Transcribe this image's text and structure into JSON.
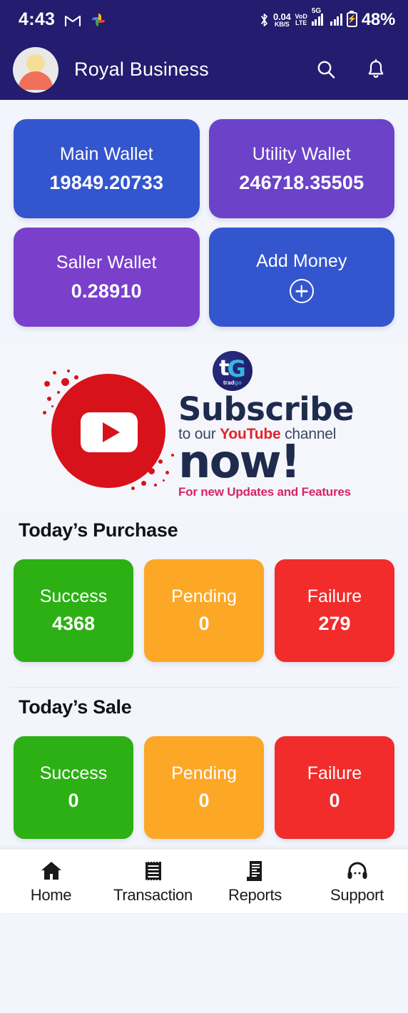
{
  "status_bar": {
    "clock": "4:43",
    "gmail_icon": "gmail-icon",
    "photos_icon": "google-photos-icon",
    "bluetooth_icon": "bluetooth-icon",
    "net_speed_value": "0.04",
    "net_speed_unit": "KB/S",
    "volte_line1": "VoD",
    "volte_line2": "LTE",
    "network_type": "5G",
    "battery_percent": "48%"
  },
  "app_bar": {
    "title": "Royal Business",
    "avatar": "user-avatar",
    "search_icon": "search-icon",
    "bell_icon": "notification-bell-icon"
  },
  "wallets": [
    {
      "label": "Main Wallet",
      "value": "19849.20733",
      "color": "#3355CE"
    },
    {
      "label": "Utility Wallet",
      "value": "246718.35505",
      "color": "#6B42C8"
    },
    {
      "label": "Saller Wallet",
      "value": "0.28910",
      "color": "#7A3FCB"
    },
    {
      "label": "Add Money",
      "value": "",
      "color": "#3355CE",
      "icon": "plus-circle-icon"
    }
  ],
  "banner": {
    "logo_t": "t",
    "logo_g": "G",
    "logo_name_a": "trad",
    "logo_name_b": "go",
    "line1": "Subscribe",
    "line2_a": "to our ",
    "line2_b": "YouTube",
    "line2_c": " channel",
    "line3": "now!",
    "line4": "For new Updates and Features",
    "play_icon": "youtube-play-icon"
  },
  "sections": [
    {
      "title": "Today’s Purchase",
      "stats": [
        {
          "label": "Success",
          "value": "4368",
          "color": "#2CB014"
        },
        {
          "label": "Pending",
          "value": "0",
          "color": "#FCA726"
        },
        {
          "label": "Failure",
          "value": "279",
          "color": "#F22B2B"
        }
      ]
    },
    {
      "title": "Today’s Sale",
      "stats": [
        {
          "label": "Success",
          "value": "0",
          "color": "#2CB014"
        },
        {
          "label": "Pending",
          "value": "0",
          "color": "#FCA726"
        },
        {
          "label": "Failure",
          "value": "0",
          "color": "#F22B2B"
        }
      ]
    }
  ],
  "bottom_nav": [
    {
      "label": "Home",
      "icon": "home-icon"
    },
    {
      "label": "Transaction",
      "icon": "receipt-icon"
    },
    {
      "label": "Reports",
      "icon": "document-report-icon"
    },
    {
      "label": "Support",
      "icon": "headset-support-icon"
    }
  ],
  "theme": {
    "navy": "#241C6E",
    "page_bg": "#F2F5FC",
    "accent_red": "#D8121A"
  }
}
